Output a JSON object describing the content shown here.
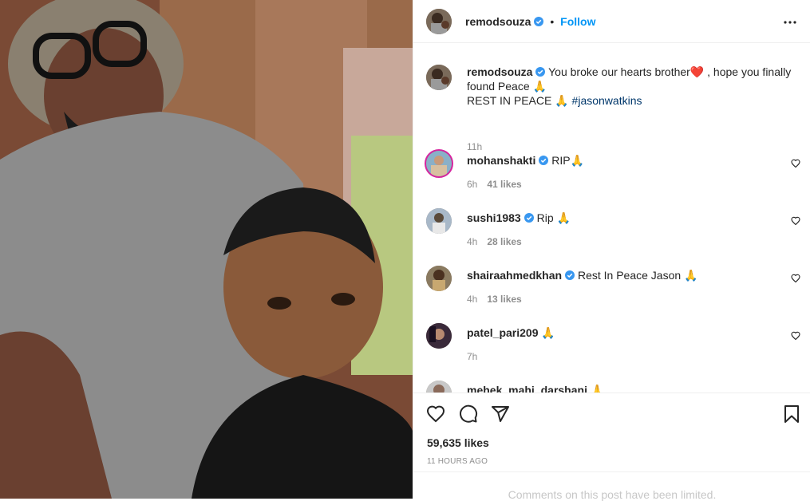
{
  "post": {
    "author": "remodsouza",
    "separator": "•",
    "follow_label": "Follow",
    "more_icon": "more-options-icon"
  },
  "caption": {
    "author": "remodsouza",
    "text_line1": "You broke our hearts brother",
    "text_line1b": ", hope you finally",
    "text_line2": "found Peace",
    "text_line3": "REST IN PEACE",
    "hashtag": "#jasonwatkins",
    "time": "11h"
  },
  "comments": [
    {
      "user": "mohanshakti",
      "verified": true,
      "text": "RIP",
      "emoji": "🙏",
      "time": "6h",
      "likes": "41 likes"
    },
    {
      "user": "sushi1983",
      "verified": true,
      "text": "Rip",
      "emoji": "🙏",
      "time": "4h",
      "likes": "28 likes"
    },
    {
      "user": "shairaahmedkhan",
      "verified": true,
      "text": "Rest In Peace Jason",
      "emoji": "🙏",
      "time": "4h",
      "likes": "13 likes"
    },
    {
      "user": "patel_pari209",
      "verified": false,
      "text": "",
      "emoji": "🙏",
      "time": "7h",
      "likes": ""
    },
    {
      "user": "mehek_mahi_darshani",
      "verified": false,
      "text": "",
      "emoji": "🙏",
      "time": "",
      "likes": ""
    }
  ],
  "actions": {
    "like_icon": "heart-icon",
    "comment_icon": "comment-icon",
    "share_icon": "share-icon",
    "save_icon": "bookmark-icon"
  },
  "stats": {
    "likes": "59,635 likes",
    "time_ago": "11 HOURS AGO"
  },
  "footer": {
    "limited": "Comments on this post have been limited."
  },
  "colors": {
    "link": "#0095f6",
    "verified": "#3897f0",
    "hashtag": "#00376b",
    "muted": "#8e8e8e"
  }
}
